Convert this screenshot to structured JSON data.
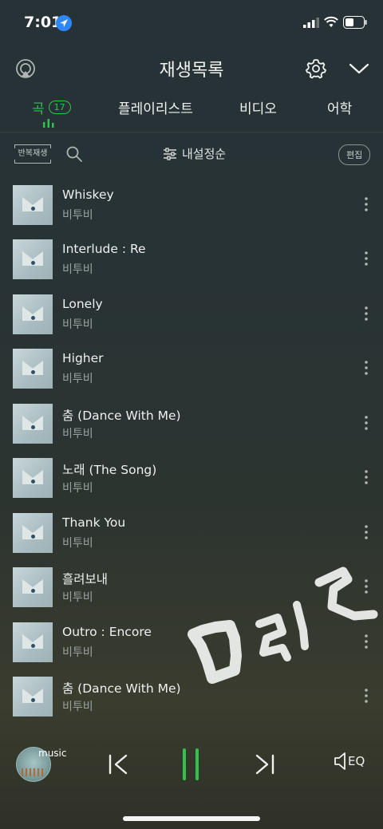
{
  "status_bar": {
    "time": "7:01"
  },
  "header": {
    "title": "재생목록"
  },
  "tabs": [
    {
      "label": "곡",
      "count": "17",
      "active": true
    },
    {
      "label": "플레이리스트"
    },
    {
      "label": "비디오"
    },
    {
      "label": "어학"
    }
  ],
  "toolbar": {
    "repeat_label": "반복재생",
    "sort_label": "내설정순",
    "edit_label": "편집"
  },
  "songs": [
    {
      "title": "Whiskey",
      "artist": "비투비"
    },
    {
      "title": "Interlude : Re",
      "artist": "비투비"
    },
    {
      "title": "Lonely",
      "artist": "비투비"
    },
    {
      "title": "Higher",
      "artist": "비투비"
    },
    {
      "title": "춤 (Dance With Me)",
      "artist": "비투비"
    },
    {
      "title": "노래 (The Song)",
      "artist": "비투비"
    },
    {
      "title": "Thank You",
      "artist": "비투비"
    },
    {
      "title": "흘려보내",
      "artist": "비투비"
    },
    {
      "title": "Outro : Encore",
      "artist": "비투비"
    },
    {
      "title": "춤 (Dance With Me)",
      "artist": "비투비"
    }
  ],
  "player": {
    "mini_label": "music",
    "eq_label": "EQ",
    "state": "playing"
  },
  "colors": {
    "accent": "#31c24e",
    "background": "#283336",
    "location": "#2f86f6"
  }
}
